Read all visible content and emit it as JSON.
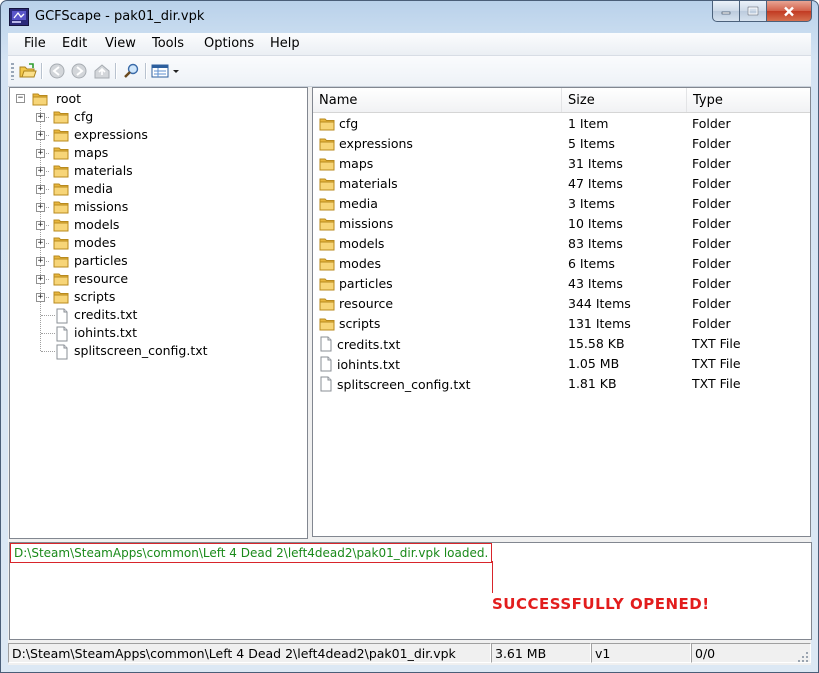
{
  "window": {
    "title": "GCFScape - pak01_dir.vpk"
  },
  "menu": {
    "items": [
      "File",
      "Edit",
      "View",
      "Tools",
      "Options",
      "Help"
    ]
  },
  "toolbar": {
    "buttons": [
      "open-folder-icon",
      "back-icon",
      "forward-icon",
      "up-icon",
      "search-icon",
      "view-mode-icon"
    ]
  },
  "tree": {
    "root": "root",
    "folders": [
      "cfg",
      "expressions",
      "maps",
      "materials",
      "media",
      "missions",
      "models",
      "modes",
      "particles",
      "resource",
      "scripts"
    ],
    "files": [
      "credits.txt",
      "iohints.txt",
      "splitscreen_config.txt"
    ]
  },
  "list": {
    "columns": {
      "name": "Name",
      "size": "Size",
      "type": "Type"
    },
    "rows": [
      {
        "name": "cfg",
        "size": "1 Item",
        "type": "Folder",
        "kind": "folder"
      },
      {
        "name": "expressions",
        "size": "5 Items",
        "type": "Folder",
        "kind": "folder"
      },
      {
        "name": "maps",
        "size": "31 Items",
        "type": "Folder",
        "kind": "folder"
      },
      {
        "name": "materials",
        "size": "47 Items",
        "type": "Folder",
        "kind": "folder"
      },
      {
        "name": "media",
        "size": "3 Items",
        "type": "Folder",
        "kind": "folder"
      },
      {
        "name": "missions",
        "size": "10 Items",
        "type": "Folder",
        "kind": "folder"
      },
      {
        "name": "models",
        "size": "83 Items",
        "type": "Folder",
        "kind": "folder"
      },
      {
        "name": "modes",
        "size": "6 Items",
        "type": "Folder",
        "kind": "folder"
      },
      {
        "name": "particles",
        "size": "43 Items",
        "type": "Folder",
        "kind": "folder"
      },
      {
        "name": "resource",
        "size": "344 Items",
        "type": "Folder",
        "kind": "folder"
      },
      {
        "name": "scripts",
        "size": "131 Items",
        "type": "Folder",
        "kind": "folder"
      },
      {
        "name": "credits.txt",
        "size": "15.58 KB",
        "type": "TXT File",
        "kind": "file"
      },
      {
        "name": "iohints.txt",
        "size": "1.05 MB",
        "type": "TXT File",
        "kind": "file"
      },
      {
        "name": "splitscreen_config.txt",
        "size": "1.81 KB",
        "type": "TXT File",
        "kind": "file"
      }
    ]
  },
  "log": {
    "message": "D:\\Steam\\SteamApps\\common\\Left 4 Dead 2\\left4dead2\\pak01_dir.vpk loaded.",
    "annotation": "SUCCESSFULLY OPENED!"
  },
  "status": {
    "path": "D:\\Steam\\SteamApps\\common\\Left 4 Dead 2\\left4dead2\\pak01_dir.vpk",
    "size": "3.61 MB",
    "version": "v1",
    "fragmentation": "0/0"
  },
  "colors": {
    "log_text": "#1a8a1a",
    "annotation": "#e21d1d",
    "highlight_border": "#d8252b"
  }
}
